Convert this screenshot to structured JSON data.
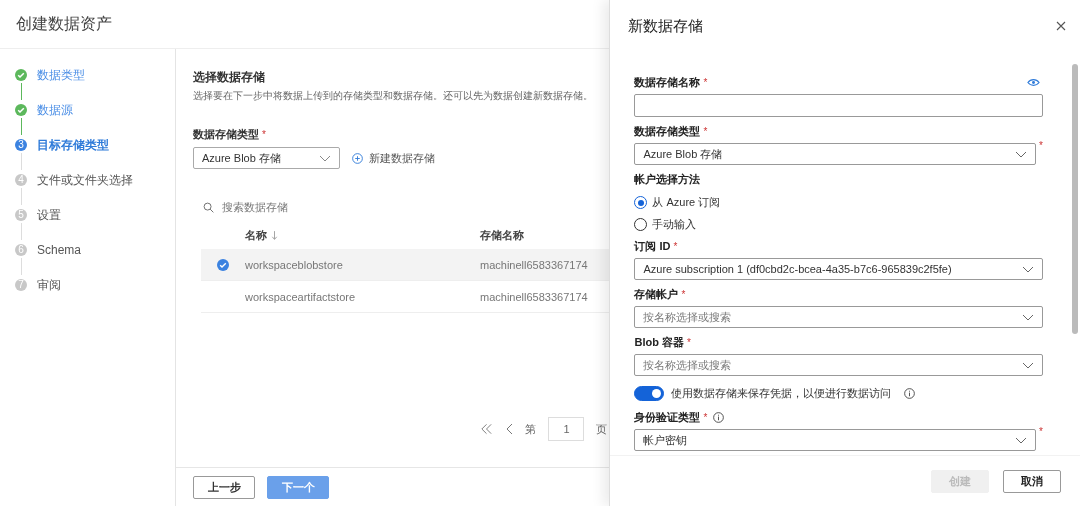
{
  "page": {
    "title": "创建数据资产"
  },
  "steps": [
    {
      "label": "数据类型",
      "completed": true,
      "active": false
    },
    {
      "label": "数据源",
      "completed": true,
      "active": false
    },
    {
      "label": "目标存储类型",
      "completed": false,
      "active": true,
      "number": "3"
    },
    {
      "label": "文件或文件夹选择",
      "completed": false,
      "active": false,
      "number": "4"
    },
    {
      "label": "设置",
      "completed": false,
      "active": false,
      "number": "5"
    },
    {
      "label": "Schema",
      "completed": false,
      "active": false,
      "number": "6"
    },
    {
      "label": "审阅",
      "completed": false,
      "active": false,
      "number": "7"
    }
  ],
  "main": {
    "heading": "选择数据存储",
    "description": "选择要在下一步中将数据上传到的存储类型和数据存储。还可以先为数据创建新数据存储。",
    "type_label": "数据存储类型",
    "type_required_mark": "*",
    "type_value": "Azure Blob 存储",
    "new_button": "新建数据存储",
    "search": {
      "placeholder": "搜索数据存储"
    },
    "table": {
      "columns": [
        "名称",
        "存储名称"
      ],
      "rows": [
        {
          "name": "workspaceblobstore",
          "storage": "machinell6583367174",
          "selected": true
        },
        {
          "name": "workspaceartifactstore",
          "storage": "machinell6583367174",
          "selected": false
        }
      ]
    },
    "pagination": {
      "prefix": "第",
      "page": "1",
      "suffix": "页"
    },
    "buttons": [
      {
        "label": "上一步",
        "kind": "secondary"
      },
      {
        "label": "下一个",
        "kind": "primary"
      }
    ]
  },
  "panel": {
    "title": "新数据存储",
    "fields": [
      {
        "kind": "text",
        "label": "数据存储名称",
        "required_mark": "*"
      },
      {
        "kind": "select",
        "label": "数据存储类型",
        "required_mark": "*",
        "value": "Azure Blob 存储",
        "side_mark": "*"
      },
      {
        "kind": "radio",
        "label": "帐户选择方法",
        "options": [
          {
            "label": "从 Azure 订阅",
            "selected": true
          },
          {
            "label": "手动输入",
            "selected": false
          }
        ]
      },
      {
        "kind": "select",
        "label": "订阅 ID",
        "required_mark": "*",
        "value": "Azure subscription 1 (df0cbd2c-bcea-4a35-b7c6-965839c2f5fe)"
      },
      {
        "kind": "select",
        "label": "存储帐户",
        "required_mark": "*",
        "placeholder": "按名称选择或搜索"
      },
      {
        "kind": "select",
        "label": "Blob 容器",
        "required_mark": "*",
        "placeholder": "按名称选择或搜索"
      },
      {
        "kind": "toggle",
        "label": "使用数据存储来保存凭据，以便进行数据访问",
        "on": true,
        "info": true
      },
      {
        "kind": "select",
        "label": "身份验证类型",
        "required_mark": "*",
        "info": true,
        "value": "帐户密钥",
        "side_mark": "*"
      }
    ],
    "buttons": [
      {
        "label": "创建",
        "disabled": true
      },
      {
        "label": "取消",
        "disabled": false
      }
    ]
  }
}
